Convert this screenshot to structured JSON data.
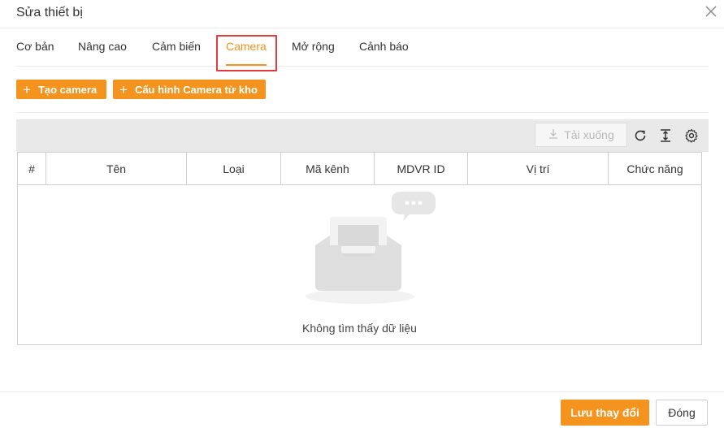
{
  "dialog": {
    "title": "Sửa thiết bị"
  },
  "tabs": [
    {
      "label": "Cơ bản"
    },
    {
      "label": "Nâng cao"
    },
    {
      "label": "Cảm biến"
    },
    {
      "label": "Camera",
      "active": true
    },
    {
      "label": "Mở rộng"
    },
    {
      "label": "Cảnh báo"
    }
  ],
  "toolbar": {
    "create_camera": "Tạo camera",
    "config_from_store": "Cấu hình Camera từ kho"
  },
  "grid_toolbar": {
    "download": "Tải xuống",
    "icons": [
      "download-icon",
      "refresh-icon",
      "column-height-icon",
      "settings-icon"
    ]
  },
  "table": {
    "columns": [
      "#",
      "Tên",
      "Loại",
      "Mã kênh",
      "MDVR ID",
      "Vị trí",
      "Chức năng"
    ],
    "rows": [],
    "empty_text": "Không tìm thấy dữ liệu"
  },
  "footer": {
    "save": "Lưu thay đổi",
    "close": "Đóng"
  },
  "colors": {
    "accent": "#f5931f",
    "highlight": "#e53b3b"
  }
}
